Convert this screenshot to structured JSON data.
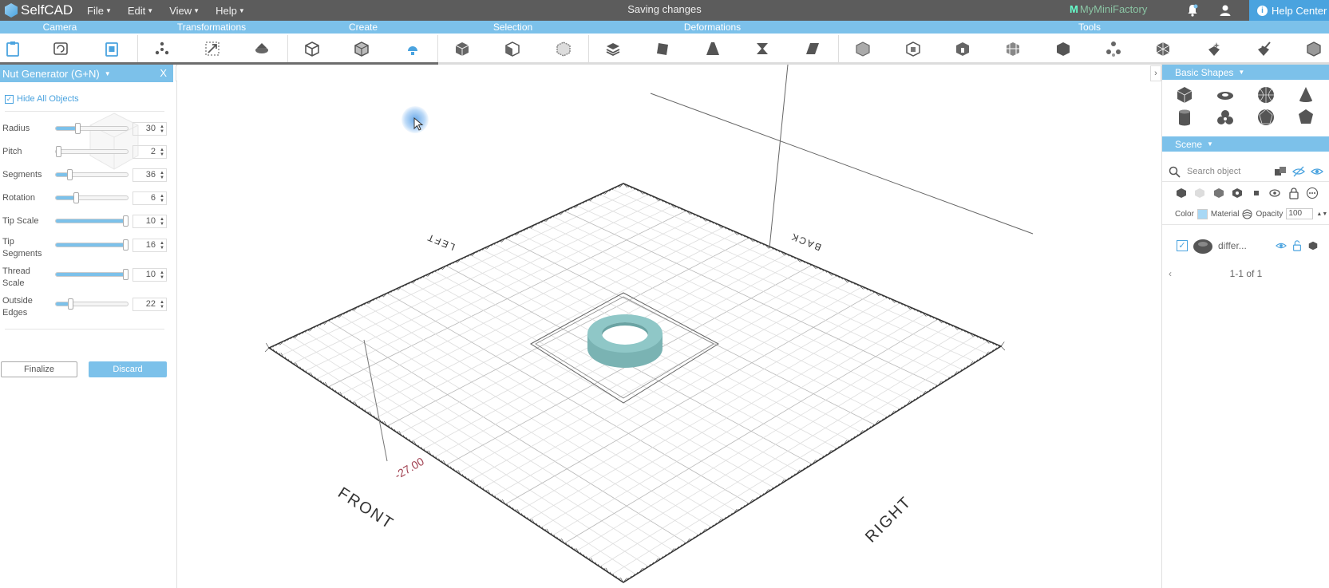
{
  "app": {
    "logo": "SelfCAD",
    "menu": [
      {
        "label": "File"
      },
      {
        "label": "Edit"
      },
      {
        "label": "View"
      },
      {
        "label": "Help"
      }
    ],
    "status": "Saving changes",
    "partner": "MyMiniFactory",
    "help_center": "Help Center"
  },
  "toolbar": {
    "sections": [
      "Camera",
      "Transformations",
      "Create",
      "Selection",
      "Deformations",
      "Tools"
    ],
    "progress": 0.33
  },
  "panel": {
    "title": "Nut Generator (G+N)",
    "close": "X",
    "hide_all": "Hide All Objects",
    "params": [
      {
        "label": "Radius",
        "value": "30",
        "level": 0.28
      },
      {
        "label": "Pitch",
        "value": "2",
        "level": 0.0
      },
      {
        "label": "Segments",
        "value": "36",
        "level": 0.17
      },
      {
        "label": "Rotation",
        "value": "6",
        "level": 0.26
      },
      {
        "label": "Tip Scale",
        "value": "10",
        "level": 1.0
      },
      {
        "label": "Tip Segments",
        "value": "16",
        "level": 1.0
      },
      {
        "label": "Thread Scale",
        "value": "10",
        "level": 1.0
      },
      {
        "label": "Outside Edges",
        "value": "22",
        "level": 0.18
      }
    ],
    "finalize": "Finalize",
    "discard": "Discard"
  },
  "viewport": {
    "labels": {
      "left": "LEFT",
      "back": "BACK",
      "front": "FRONT",
      "right": "RIGHT"
    },
    "measure": "-27.00",
    "object_color": "#8fc7c7"
  },
  "right": {
    "basic_shapes": "Basic Shapes",
    "scene": "Scene",
    "search_placeholder": "Search object",
    "color_label": "Color",
    "material_label": "Material",
    "opacity_label": "Opacity",
    "opacity_value": "100",
    "object_name": "differ...",
    "pager": "1-1 of 1"
  }
}
